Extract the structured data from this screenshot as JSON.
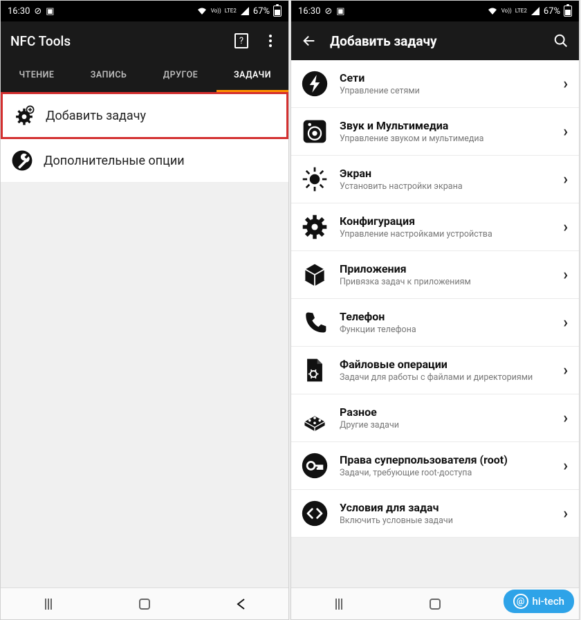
{
  "status": {
    "time": "16:30",
    "battery": "67%",
    "net1": "Vo))",
    "net2": "LTE2"
  },
  "left": {
    "title": "NFC Tools",
    "tabs": [
      "ЧТЕНИЕ",
      "ЗАПИСЬ",
      "ДРУГОЕ",
      "ЗАДАЧИ"
    ],
    "active_tab": 3,
    "rows": [
      {
        "label": "Добавить задачу",
        "icon": "gear-plus-icon",
        "highlight": true
      },
      {
        "label": "Дополнительные опции",
        "icon": "wrench-icon",
        "highlight": false
      }
    ]
  },
  "right": {
    "title": "Добавить задачу",
    "categories": [
      {
        "title": "Сети",
        "sub": "Управление сетями",
        "icon": "bolt-icon"
      },
      {
        "title": "Звук и Мультимедиа",
        "sub": "Управление звуком и мультимедиа",
        "icon": "speaker-icon"
      },
      {
        "title": "Экран",
        "sub": "Установить настройки экрана",
        "icon": "brightness-icon"
      },
      {
        "title": "Конфигурация",
        "sub": "Управление настройками устройства",
        "icon": "gear-icon"
      },
      {
        "title": "Приложения",
        "sub": "Привязка задач к приложениям",
        "icon": "cube-icon"
      },
      {
        "title": "Телефон",
        "sub": "Функции телефона",
        "icon": "phone-icon"
      },
      {
        "title": "Файловые операции",
        "sub": "Задачи для работы с файлами и директориями",
        "icon": "file-gear-icon"
      },
      {
        "title": "Разное",
        "sub": "Другие задачи",
        "icon": "bricks-icon"
      },
      {
        "title": "Права суперпользователя (root)",
        "sub": "Задачи, требующие root-доступа",
        "icon": "key-icon"
      },
      {
        "title": "Условия для задач",
        "sub": "Включить условные задачи",
        "icon": "code-icon"
      }
    ]
  },
  "watermark": "hi-tech"
}
